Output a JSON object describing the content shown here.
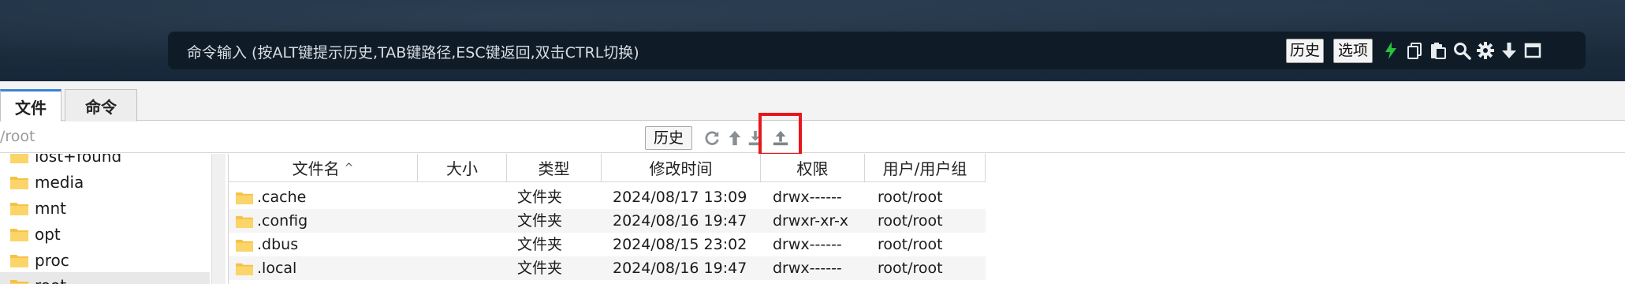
{
  "command_bar": {
    "input_hint": "命令输入 (按ALT键提示历史,TAB键路径,ESC键返回,双击CTRL切换)",
    "history_button": "历史",
    "options_button": "选项",
    "icons": [
      "lightning-icon",
      "copy-icon",
      "paste-icon",
      "search-icon",
      "gear-icon",
      "arrow-down-icon",
      "maximize-icon"
    ]
  },
  "tabs": [
    {
      "label": "文件",
      "active": true
    },
    {
      "label": "命令",
      "active": false
    }
  ],
  "path_bar": {
    "path": "/root",
    "history_button": "历史",
    "icons": [
      "refresh-icon",
      "up-arrow-icon",
      "download-icon",
      "upload-icon"
    ]
  },
  "tree": {
    "items": [
      {
        "label": "lost+found"
      },
      {
        "label": "media"
      },
      {
        "label": "mnt"
      },
      {
        "label": "opt"
      },
      {
        "label": "proc"
      },
      {
        "label": "root",
        "selected": true
      }
    ]
  },
  "file_table": {
    "columns": [
      "文件名",
      "大小",
      "类型",
      "修改时间",
      "权限",
      "用户/用户组"
    ],
    "rows": [
      {
        "name": ".cache",
        "size": "",
        "type": "文件夹",
        "modified": "2024/08/17 13:09",
        "perm": "drwx------",
        "owner": "root/root"
      },
      {
        "name": ".config",
        "size": "",
        "type": "文件夹",
        "modified": "2024/08/16 19:47",
        "perm": "drwxr-xr-x",
        "owner": "root/root"
      },
      {
        "name": ".dbus",
        "size": "",
        "type": "文件夹",
        "modified": "2024/08/15 23:02",
        "perm": "drwx------",
        "owner": "root/root"
      },
      {
        "name": ".local",
        "size": "",
        "type": "文件夹",
        "modified": "2024/08/16 19:47",
        "perm": "drwx------",
        "owner": "root/root"
      }
    ]
  },
  "colors": {
    "accent": "#3b82d6",
    "highlight": "#e8171b",
    "lightning": "#28c03c",
    "folder": "#f6c244"
  }
}
